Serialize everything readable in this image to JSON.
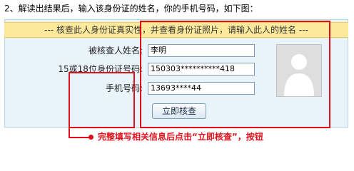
{
  "instruction": "2、解读出结果后，输入该身份证的姓名，你的手机号码，如下图：",
  "banner": "--- 核查此人身份证真实性，并查看身份证照片，请输入此人的姓名 ---",
  "form": {
    "name_label": "被核查人姓名:",
    "name_value": "李明",
    "id_label": "15或18位身份证号码:",
    "id_value": "150303**********418",
    "phone_label": "手机号码:",
    "phone_value": "13693****44",
    "submit_label": "立即核查"
  },
  "photo": {
    "icon": "person-silhouette-icon"
  },
  "annotation": {
    "note": "完整填写相关信息后点击“立即核查”，按钮",
    "color": "#e0101a"
  },
  "colors": {
    "panel_bg": "#e9f3fa",
    "banner_bg": "#fde99c",
    "highlight": "#e0101a"
  }
}
